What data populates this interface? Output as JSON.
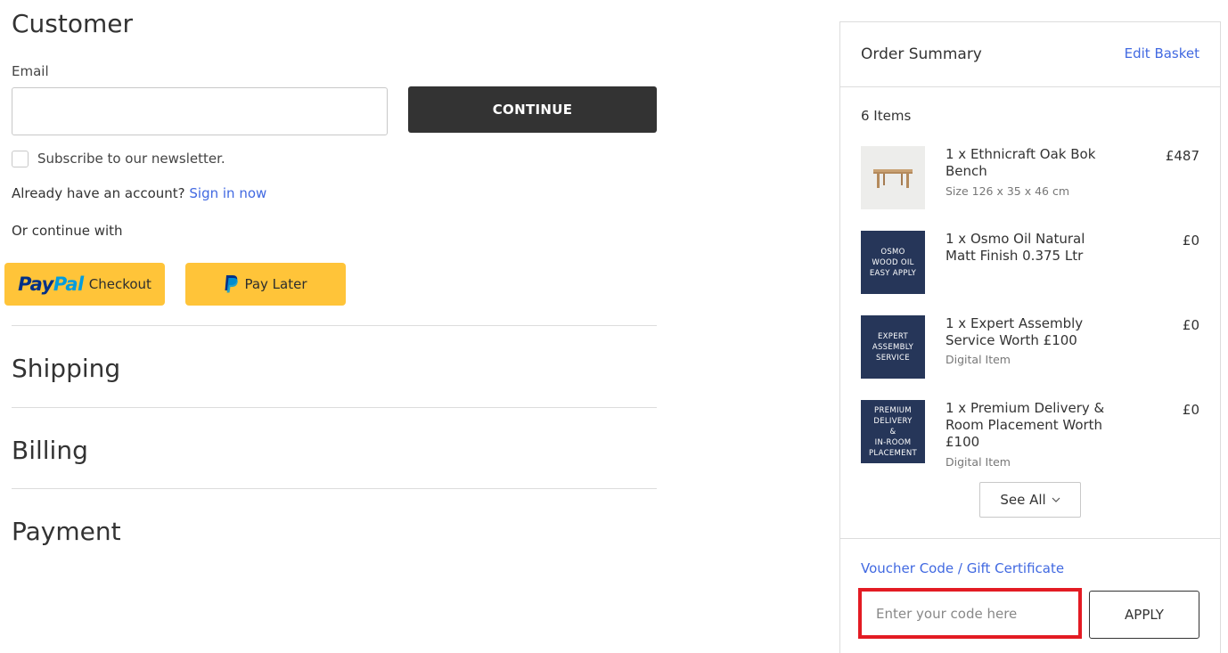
{
  "customer": {
    "heading": "Customer",
    "email_label": "Email",
    "email_value": "",
    "email_placeholder": "",
    "continue_label": "CONTINUE",
    "newsletter_label": "Subscribe to our newsletter.",
    "newsletter_checked": false,
    "account_prompt": "Already have an account?",
    "sign_in_label": "Sign in now",
    "continue_with_label": "Or continue with",
    "paypal_checkout": {
      "brand_dark": "Pay",
      "brand_light": "Pal",
      "label": "Checkout"
    },
    "paypal_later": {
      "label": "Pay Later"
    }
  },
  "sections": {
    "shipping": "Shipping",
    "billing": "Billing",
    "payment": "Payment"
  },
  "summary": {
    "title": "Order Summary",
    "edit_label": "Edit Basket",
    "item_count": "6 Items",
    "items": [
      {
        "name": "1 x Ethnicraft Oak Bok Bench",
        "sub": "Size 126 x 35 x 46 cm",
        "price": "£487",
        "thumb": "bench-image"
      },
      {
        "name": "1 x Osmo Oil Natural Matt Finish 0.375 Ltr",
        "sub": "",
        "price": "£0",
        "thumb_lines": [
          "OSMO",
          "WOOD OIL",
          "EASY APPLY"
        ]
      },
      {
        "name": "1 x Expert Assembly Service Worth £100",
        "sub": "Digital Item",
        "price": "£0",
        "thumb_lines": [
          "EXPERT",
          "ASSEMBLY",
          "SERVICE"
        ]
      },
      {
        "name": "1 x Premium Delivery & Room Placement Worth £100",
        "sub": "Digital Item",
        "price": "£0",
        "thumb_lines": [
          "PREMIUM",
          "DELIVERY",
          "&",
          "IN-ROOM",
          "PLACEMENT"
        ]
      }
    ],
    "see_all_label": "See All",
    "voucher_label": "Voucher Code / Gift Certificate",
    "voucher_placeholder": "Enter your code here",
    "voucher_value": "",
    "apply_label": "APPLY"
  },
  "colors": {
    "link": "#4169e1",
    "button_dark": "#333333",
    "paypal_yellow": "#ffc439",
    "thumb_navy": "#263659",
    "highlight_red": "#e31b23"
  },
  "icons": {
    "see_all": "chevron-down-icon",
    "pay_later": "paypal-p-icon"
  }
}
